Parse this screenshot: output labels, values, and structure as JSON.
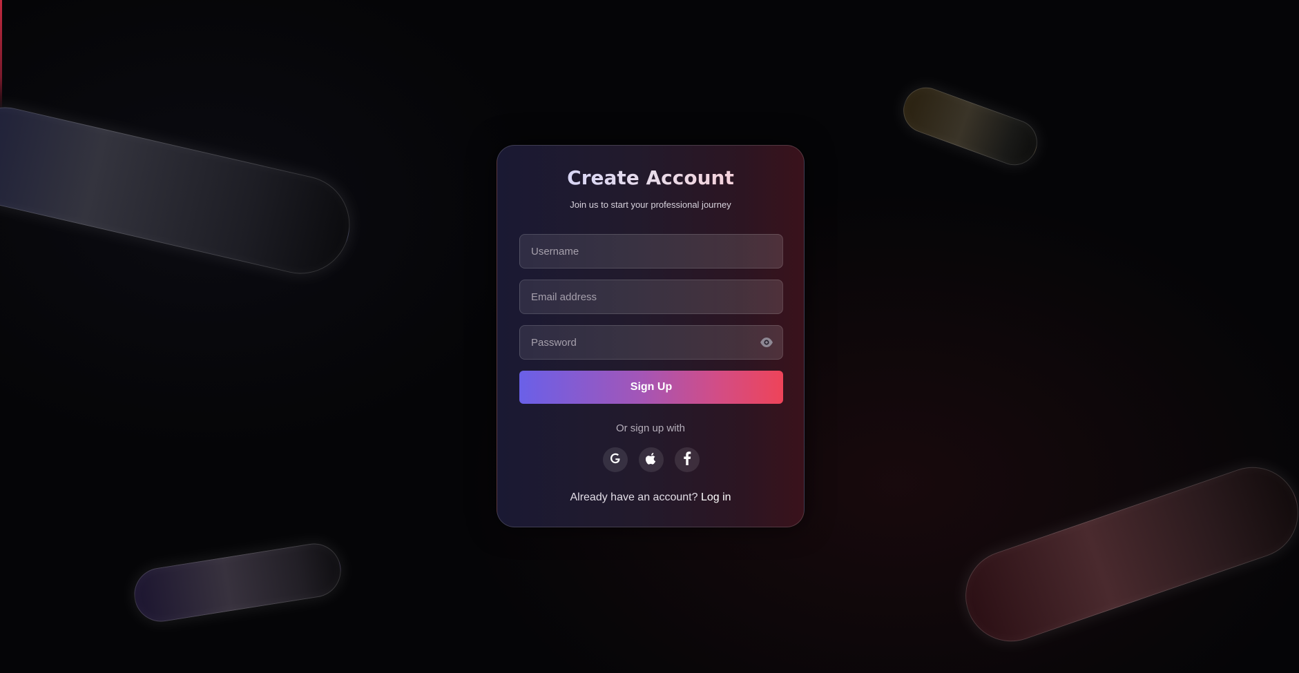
{
  "page": {
    "accent_colors": {
      "button_start": "#6a60e8",
      "button_end": "#ee4459",
      "card_left": "#1a1933",
      "card_right": "#3a121b",
      "background": "#050507"
    }
  },
  "card": {
    "title": "Create Account",
    "subtitle": "Join us to start your professional journey"
  },
  "form": {
    "username_placeholder": "Username",
    "username_value": "",
    "email_placeholder": "Email address",
    "email_value": "",
    "password_placeholder": "Password",
    "password_value": "",
    "password_toggle_icon": "eye-icon",
    "submit_label": "Sign Up"
  },
  "social": {
    "divider_text": "Or sign up with",
    "providers": [
      {
        "name": "Google",
        "icon": "google-icon"
      },
      {
        "name": "Apple",
        "icon": "apple-icon"
      },
      {
        "name": "Facebook",
        "icon": "facebook-icon"
      }
    ]
  },
  "footer": {
    "prompt": "Already have an account?",
    "link_label": "Log in"
  }
}
